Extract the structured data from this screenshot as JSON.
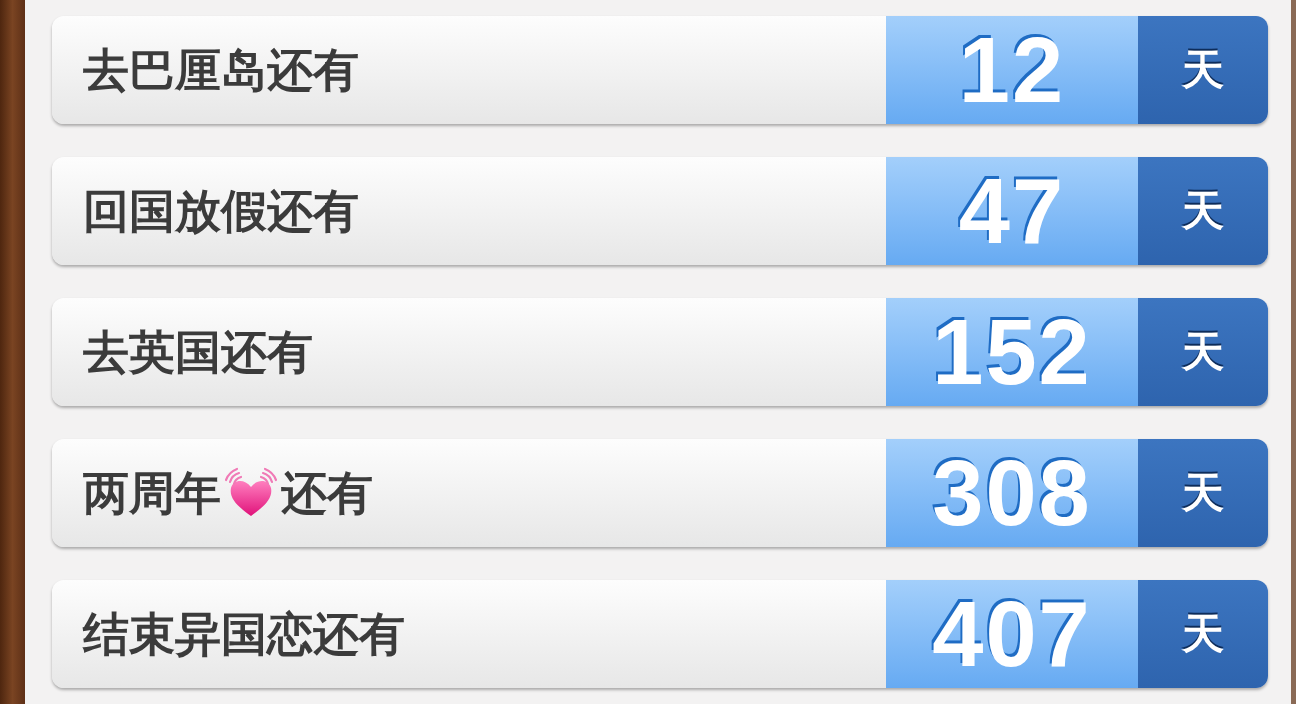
{
  "countdowns": [
    {
      "label_parts": [
        {
          "kind": "text",
          "text": "去巴厘岛还有"
        }
      ],
      "days": "12",
      "unit": "天"
    },
    {
      "label_parts": [
        {
          "kind": "text",
          "text": "回国放假还有"
        }
      ],
      "days": "47",
      "unit": "天"
    },
    {
      "label_parts": [
        {
          "kind": "text",
          "text": "去英国还有"
        }
      ],
      "days": "152",
      "unit": "天"
    },
    {
      "label_parts": [
        {
          "kind": "text",
          "text": "两周年"
        },
        {
          "kind": "emoji"
        },
        {
          "kind": "text",
          "text": "还有"
        }
      ],
      "days": "308",
      "unit": "天"
    },
    {
      "label_parts": [
        {
          "kind": "text",
          "text": "结束异国恋还有"
        }
      ],
      "days": "407",
      "unit": "天"
    }
  ]
}
